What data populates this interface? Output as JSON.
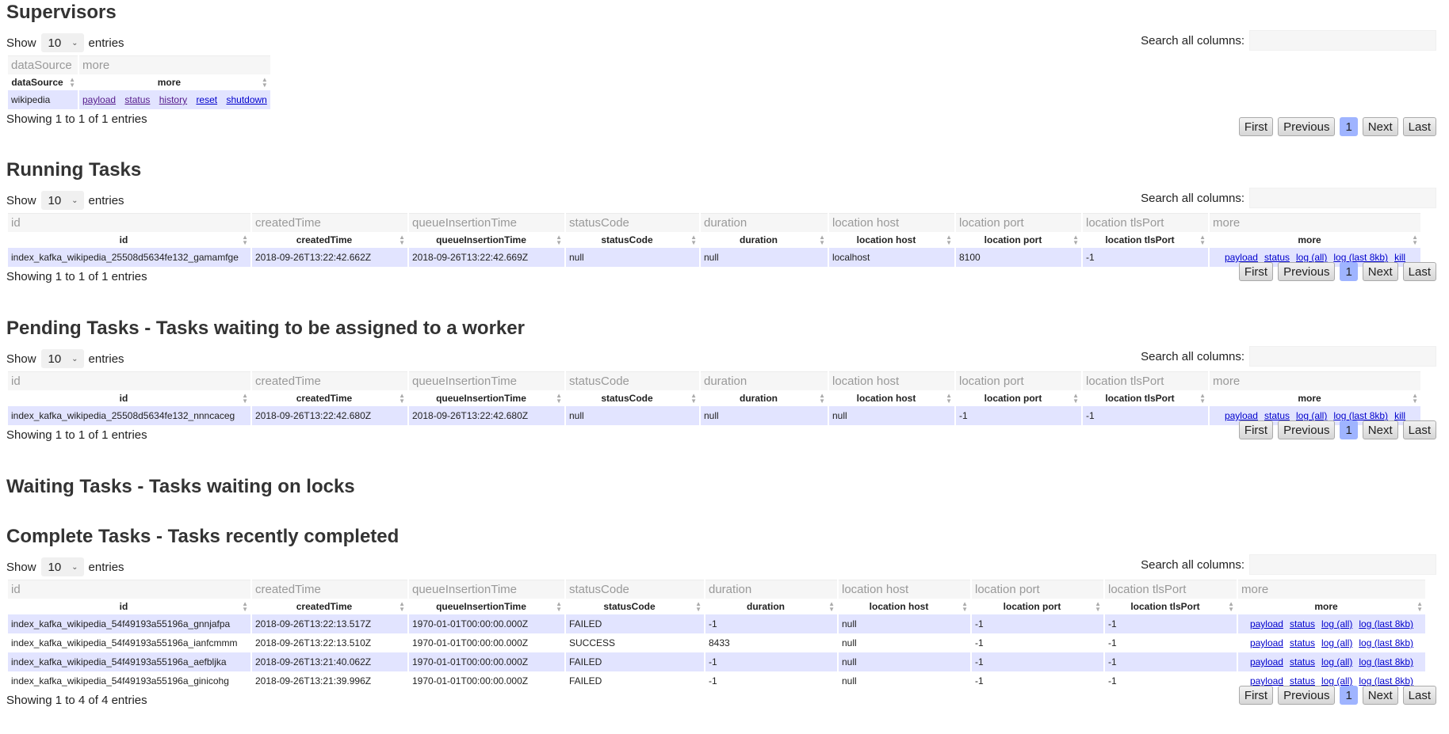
{
  "common": {
    "show": "Show",
    "entries": "entries",
    "entries_value": "10",
    "search_label": "Search all columns:",
    "pager": {
      "first": "First",
      "previous": "Previous",
      "page": "1",
      "next": "Next",
      "last": "Last"
    }
  },
  "supervisors": {
    "title": "Supervisors",
    "columns": [
      "dataSource",
      "more"
    ],
    "rows": [
      {
        "dataSource": "wikipedia",
        "links": [
          "payload",
          "status",
          "history",
          "reset",
          "shutdown"
        ]
      }
    ],
    "info": "Showing 1 to 1 of 1 entries"
  },
  "running": {
    "title": "Running Tasks",
    "columns": [
      "id",
      "createdTime",
      "queueInsertionTime",
      "statusCode",
      "duration",
      "location host",
      "location port",
      "location tlsPort",
      "more"
    ],
    "rows": [
      {
        "cells": [
          "index_kafka_wikipedia_25508d5634fe132_gamamfge",
          "2018-09-26T13:22:42.662Z",
          "2018-09-26T13:22:42.669Z",
          "null",
          "null",
          "localhost",
          "8100",
          "-1"
        ],
        "links": [
          "payload",
          "status",
          "log (all)",
          "log (last 8kb)",
          "kill"
        ]
      }
    ],
    "info": "Showing 1 to 1 of 1 entries"
  },
  "pending": {
    "title": "Pending Tasks - Tasks waiting to be assigned to a worker",
    "columns": [
      "id",
      "createdTime",
      "queueInsertionTime",
      "statusCode",
      "duration",
      "location host",
      "location port",
      "location tlsPort",
      "more"
    ],
    "rows": [
      {
        "cells": [
          "index_kafka_wikipedia_25508d5634fe132_nnncaceg",
          "2018-09-26T13:22:42.680Z",
          "2018-09-26T13:22:42.680Z",
          "null",
          "null",
          "null",
          "-1",
          "-1"
        ],
        "links": [
          "payload",
          "status",
          "log (all)",
          "log (last 8kb)",
          "kill"
        ]
      }
    ],
    "info": "Showing 1 to 1 of 1 entries"
  },
  "waiting": {
    "title": "Waiting Tasks - Tasks waiting on locks"
  },
  "complete": {
    "title": "Complete Tasks - Tasks recently completed",
    "columns": [
      "id",
      "createdTime",
      "queueInsertionTime",
      "statusCode",
      "duration",
      "location host",
      "location port",
      "location tlsPort",
      "more"
    ],
    "rows": [
      {
        "cells": [
          "index_kafka_wikipedia_54f49193a55196a_gnnjafpa",
          "2018-09-26T13:22:13.517Z",
          "1970-01-01T00:00:00.000Z",
          "FAILED",
          "-1",
          "null",
          "-1",
          "-1"
        ],
        "links": [
          "payload",
          "status",
          "log (all)",
          "log (last 8kb)"
        ]
      },
      {
        "cells": [
          "index_kafka_wikipedia_54f49193a55196a_ianfcmmm",
          "2018-09-26T13:22:13.510Z",
          "1970-01-01T00:00:00.000Z",
          "SUCCESS",
          "8433",
          "null",
          "-1",
          "-1"
        ],
        "links": [
          "payload",
          "status",
          "log (all)",
          "log (last 8kb)"
        ]
      },
      {
        "cells": [
          "index_kafka_wikipedia_54f49193a55196a_aefbljka",
          "2018-09-26T13:21:40.062Z",
          "1970-01-01T00:00:00.000Z",
          "FAILED",
          "-1",
          "null",
          "-1",
          "-1"
        ],
        "links": [
          "payload",
          "status",
          "log (all)",
          "log (last 8kb)"
        ]
      },
      {
        "cells": [
          "index_kafka_wikipedia_54f49193a55196a_ginicohg",
          "2018-09-26T13:21:39.996Z",
          "1970-01-01T00:00:00.000Z",
          "FAILED",
          "-1",
          "null",
          "-1",
          "-1"
        ],
        "links": [
          "payload",
          "status",
          "log (all)",
          "log (last 8kb)"
        ]
      }
    ],
    "info": "Showing 1 to 4 of 4 entries"
  }
}
